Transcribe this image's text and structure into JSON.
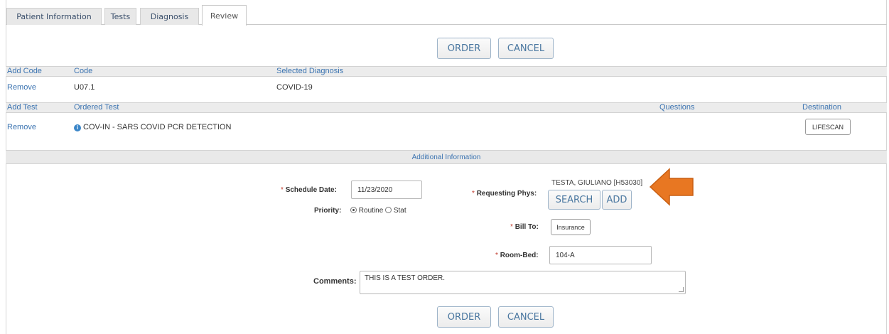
{
  "tabs": [
    {
      "label": "Patient Information"
    },
    {
      "label": "Tests"
    },
    {
      "label": "Diagnosis"
    },
    {
      "label": "Review"
    }
  ],
  "actions": {
    "order": "ORDER",
    "cancel": "CANCEL"
  },
  "diagnosis": {
    "headers": {
      "add": "Add Code",
      "code": "Code",
      "selected": "Selected Diagnosis"
    },
    "rows": [
      {
        "remove": "Remove",
        "code": "U07.1",
        "diagnosis": "COVID-19"
      }
    ]
  },
  "tests": {
    "headers": {
      "add": "Add Test",
      "ordered": "Ordered Test",
      "questions": "Questions",
      "destination": "Destination"
    },
    "rows": [
      {
        "remove": "Remove",
        "test": "COV-IN - SARS COVID PCR DETECTION",
        "destination": "LIFESCAN",
        "icon": "info-icon"
      }
    ]
  },
  "additional": {
    "title": "Additional Information",
    "schedule_label": "Schedule Date:",
    "schedule_value": "11/23/2020",
    "priority_label": "Priority:",
    "priority_options": [
      "Routine",
      "Stat"
    ],
    "priority_selected": "Routine",
    "phys_label": "Requesting Phys:",
    "phys_value": "TESTA, GIULIANO [H53030]",
    "search": "SEARCH",
    "add": "ADD",
    "billto_label": "Bill To:",
    "billto_value": "Insurance",
    "room_label": "Room-Bed:",
    "room_value": "104-A",
    "comments_label": "Comments:",
    "comments_value": "THIS IS A TEST ORDER."
  },
  "colors": {
    "link": "#3c74b1",
    "arrow": "#e87722"
  }
}
